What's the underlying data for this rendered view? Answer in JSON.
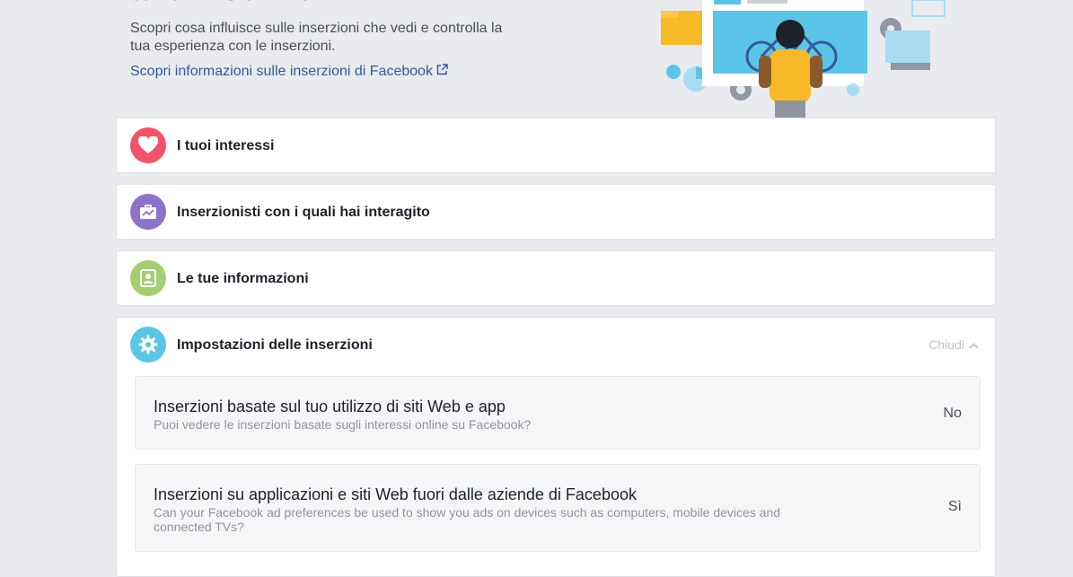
{
  "hero": {
    "title": "alle inserzioni",
    "description": "Scopri cosa influisce sulle inserzioni che vedi e controlla la tua esperienza con le inserzioni.",
    "link_label": "Scopri informazioni sulle inserzioni di Facebook",
    "link_icon": "external-link-icon"
  },
  "categories": [
    {
      "label": "I tuoi interessi",
      "icon": "heart-icon",
      "color": "#f35369"
    },
    {
      "label": "Inserzionisti con i quali hai interagito",
      "icon": "briefcase-icon",
      "color": "#8c72cb"
    },
    {
      "label": "Le tue informazioni",
      "icon": "contact-card-icon",
      "color": "#a3ce71"
    },
    {
      "label": "Impostazioni delle inserzioni",
      "icon": "gear-icon",
      "color": "#5bc5e8",
      "expanded": true,
      "close_label": "Chiudi"
    }
  ],
  "settings": [
    {
      "title": "Inserzioni basate sul tuo utilizzo di siti Web e app",
      "description": "Puoi vedere le inserzioni basate sugli interessi online su Facebook?",
      "value": "No"
    },
    {
      "title": "Inserzioni su applicazioni e siti Web fuori dalle aziende di Facebook",
      "description": "Can your Facebook ad preferences be used to show you ads on devices such as computers, mobile devices and connected TVs?",
      "value": "Sì"
    }
  ],
  "colors": {
    "background": "#e9ebee",
    "link": "#365899",
    "card_border": "#dddfe2"
  }
}
